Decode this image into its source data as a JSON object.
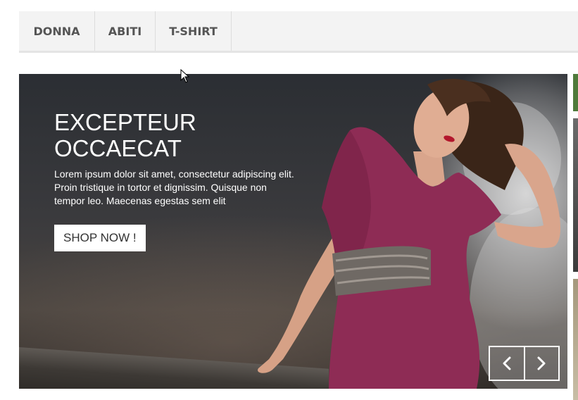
{
  "nav": {
    "items": [
      {
        "label": "DONNA"
      },
      {
        "label": "ABITI"
      },
      {
        "label": "T-SHIRT"
      }
    ]
  },
  "hero": {
    "title": "EXCEPTEUR OCCAECAT",
    "text": "Lorem ipsum dolor sit amet, consectetur adipiscing elit. Proin tristique in tortor et dignissim. Quisque non tempor leo. Maecenas egestas sem elit",
    "cta_label": "SHOP NOW !",
    "prev_icon": "chevron-left-icon",
    "next_icon": "chevron-right-icon"
  },
  "colors": {
    "dress": "#8e2c55",
    "nav_bg": "#f3f3f3",
    "nav_text": "#555555"
  }
}
